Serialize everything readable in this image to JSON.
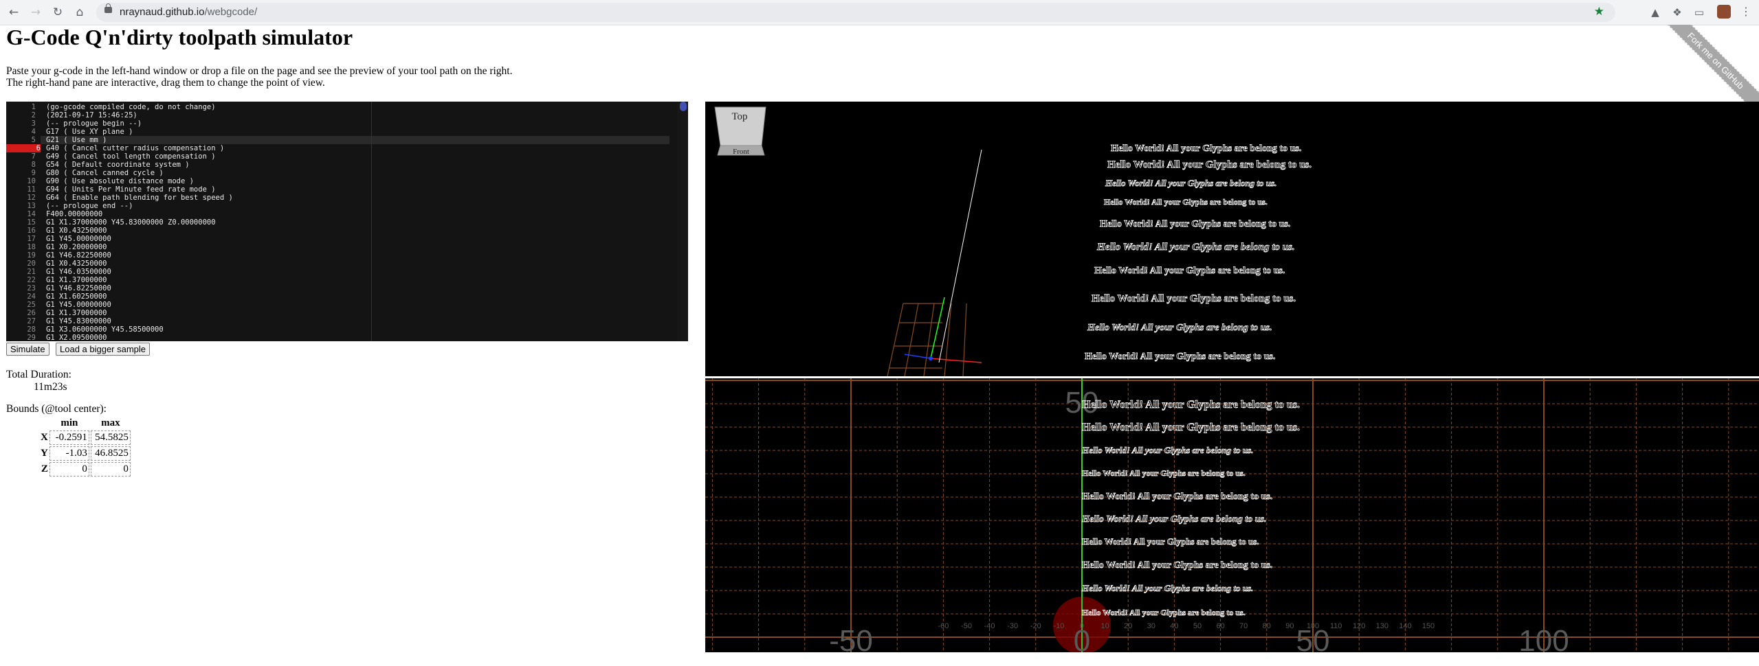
{
  "browser": {
    "url_host": "nraynaud.github.io",
    "url_path": "/webgcode/"
  },
  "page": {
    "title": "G-Code Q'n'dirty toolpath simulator",
    "intro_line1": "Paste your g-code in the left-hand window or drop a file on the page and see the preview of your tool path on the right.",
    "intro_line2": "The right-hand pane are interactive, drag them to change the point of view.",
    "ribbon": "Fork me on GitHub"
  },
  "editor": {
    "error_line": 6,
    "active_line": 5,
    "lines": [
      "(go-gcode compiled code, do not change)",
      "(2021-09-17 15:46:25)",
      "(-- prologue begin --)",
      "G17 ( Use XY plane )",
      "G21 ( Use mm )",
      "G40 ( Cancel cutter radius compensation )",
      "G49 ( Cancel tool length compensation )",
      "G54 ( Default coordinate system )",
      "G80 ( Cancel canned cycle )",
      "G90 ( Use absolute distance mode )",
      "G94 ( Units Per Minute feed rate mode )",
      "G64 ( Enable path blending for best speed )",
      "(-- prologue end --)",
      "F400.00000000",
      "G1 X1.37000000 Y45.83000000 Z0.00000000",
      "G1 X0.43250000",
      "G1 Y45.00000000",
      "G1 X0.20000000",
      "G1 Y46.82250000",
      "G1 X0.43250000",
      "G1 Y46.03500000",
      "G1 X1.37000000",
      "G1 Y46.82250000",
      "G1 X1.60250000",
      "G1 Y45.00000000",
      "G1 X1.37000000",
      "G1 Y45.83000000",
      "G1 X3.06000000 Y45.58500000",
      "G1 X2.09500000"
    ]
  },
  "buttons": {
    "simulate": "Simulate",
    "bigger": "Load a bigger sample"
  },
  "stats": {
    "duration_label": "Total Duration:",
    "duration_value": "11m23s",
    "bounds_label": "Bounds (@tool center):",
    "min_header": "min",
    "max_header": "max",
    "x_label": "X",
    "y_label": "Y",
    "z_label": "Z",
    "x_min": "-0.2591",
    "x_max": "54.5825",
    "y_min": "-1.03",
    "y_max": "46.8525",
    "z_min": "0",
    "z_max": "0"
  },
  "viewcube": {
    "top": "Top",
    "front": "Front"
  },
  "preview_text": "Hello World! All your Glyphs are belong to us.",
  "axis_labels": {
    "big": [
      "-50",
      "0",
      "50",
      "100"
    ],
    "small": [
      "-60",
      "-50",
      "-40",
      "-30",
      "-20",
      "-10",
      "0",
      "10",
      "20",
      "30",
      "40",
      "50",
      "60",
      "70",
      "80",
      "90",
      "100",
      "110",
      "120",
      "130",
      "140",
      "150"
    ],
    "center_top": "50"
  },
  "colors": {
    "grid": "#8a4a1c",
    "toolpath": "#ffffff",
    "x_axis": "#ff2020",
    "y_axis": "#20ff20",
    "z_axis": "#2040ff",
    "error_marker": "#d41b1b"
  }
}
